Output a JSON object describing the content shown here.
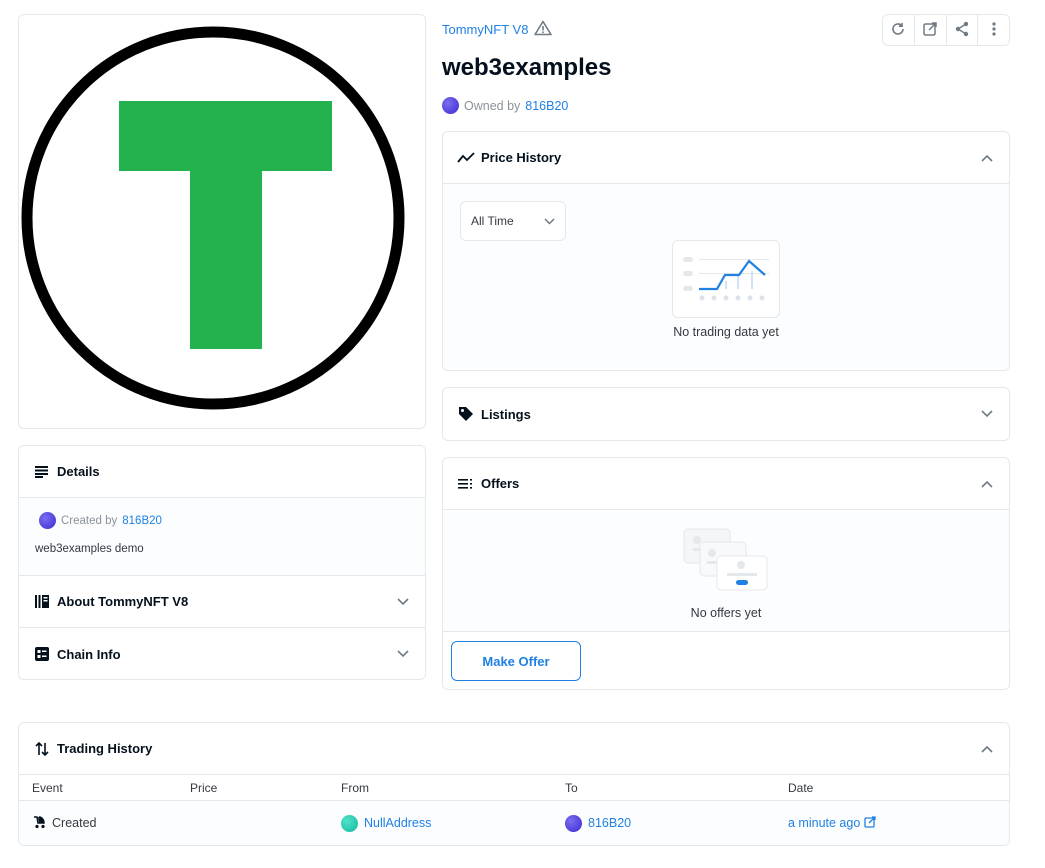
{
  "collection": {
    "name": "TommyNFT V8",
    "warning_icon": "warning-triangle-icon"
  },
  "toolbar": {
    "icons": [
      "refresh-icon",
      "external-link-icon",
      "share-icon",
      "more-vertical-icon"
    ]
  },
  "asset": {
    "title": "web3examples",
    "owned_by_label": "Owned by",
    "owner": "816B20"
  },
  "image": {
    "letter_color": "#24b24f",
    "ring_color": "#000000"
  },
  "details": {
    "header": "Details",
    "created_by_label": "Created by",
    "creator": "816B20",
    "description": "web3examples demo",
    "about_label": "About TommyNFT V8",
    "chain_label": "Chain Info"
  },
  "price_history": {
    "header": "Price History",
    "range": "All Time",
    "empty_text": "No trading data yet"
  },
  "listings": {
    "header": "Listings"
  },
  "offers": {
    "header": "Offers",
    "empty_text": "No offers yet",
    "make_offer_label": "Make Offer"
  },
  "trading_history": {
    "header": "Trading History",
    "columns": [
      "Event",
      "Price",
      "From",
      "To",
      "Date"
    ],
    "rows": [
      {
        "event": "Created",
        "price": "",
        "from": "NullAddress",
        "to": "816B20",
        "date": "a minute ago"
      }
    ]
  },
  "colors": {
    "link": "#2081e2",
    "border": "#e5e8eb",
    "text": "#04111d"
  }
}
